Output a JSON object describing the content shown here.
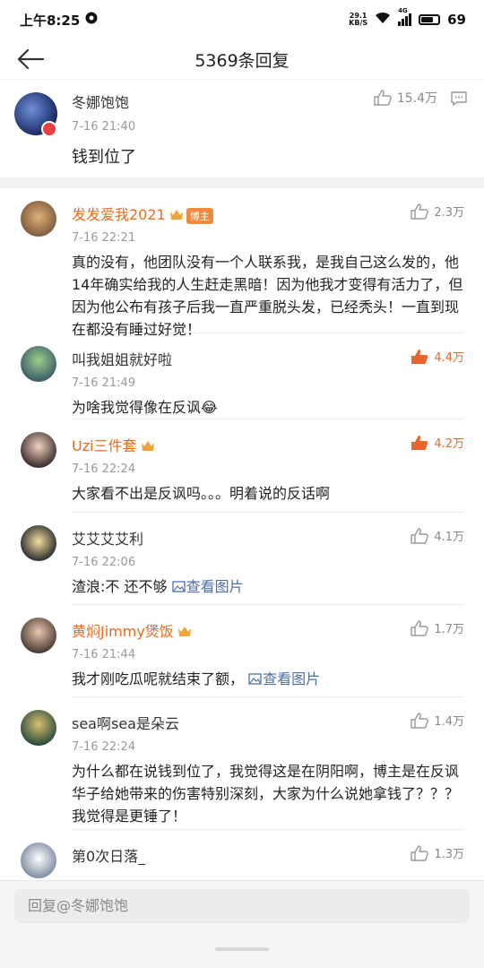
{
  "status_bar": {
    "time": "上午8:25",
    "net_speed_value": "29.1",
    "net_speed_unit": "KB/S",
    "signal_label": "4G",
    "battery": "69"
  },
  "header": {
    "title": "5369条回复"
  },
  "main_comment": {
    "name": "冬娜饱饱",
    "time": "7-16 21:40",
    "likes": "15.4万",
    "text": "钱到位了"
  },
  "replies": [
    {
      "name": "发发爱我2021",
      "badge": "博主",
      "time": "7-16 22:21",
      "likes": "2.3万",
      "text": "真的没有，他团队没有一个人联系我，是我自己这么发的，他14年确实给我的人生赶走黑暗！因为他我才变得有活力了，但因为他公布有孩子后我一直严重脱头发，已经秃头！一直到现在都没有睡过好觉！"
    },
    {
      "name": "叫我姐姐就好啦",
      "time": "7-16 21:49",
      "likes": "4.4万",
      "text": "为啥我觉得像在反讽😂"
    },
    {
      "name": "Uzi三件套",
      "time": "7-16 22:24",
      "likes": "4.2万",
      "text": "大家看不出是反讽吗。。。明着说的反话啊"
    },
    {
      "name": "艾艾艾艾利",
      "time": "7-16 22:06",
      "likes": "4.1万",
      "text": "渣浪:不 还不够 ",
      "link": "查看图片"
    },
    {
      "name": "黄焖Jimmy煲饭",
      "time": "7-16 21:44",
      "likes": "1.7万",
      "text": "我才刚吃瓜呢就结束了额， ",
      "link": "查看图片"
    },
    {
      "name": "sea啊sea是朵云",
      "time": "7-16 22:24",
      "likes": "1.4万",
      "text": "为什么都在说钱到位了，我觉得这是在阴阳啊，博主是在反讽华子给她带来的伤害特别深刻，大家为什么说她拿钱了？？？我觉得是更锤了！"
    },
    {
      "name": "第0次日落_",
      "likes": "1.3万"
    }
  ],
  "reply_input": {
    "placeholder": "回复@冬娜饱饱"
  },
  "colors": {
    "orange_name": "#e86d1f",
    "hot_like": "#e8652e",
    "link": "#4e6fa8"
  }
}
